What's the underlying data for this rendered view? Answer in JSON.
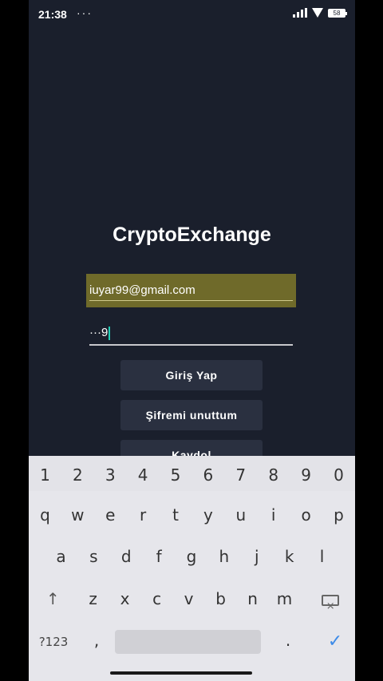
{
  "status": {
    "time": "21:38",
    "dots": "···",
    "battery": "58"
  },
  "app": {
    "title": "CryptoExchange"
  },
  "form": {
    "email_value": "iuyar99@gmail.com",
    "password_value": "···9",
    "login_label": "Giriş Yap",
    "forgot_label": "Şifremi unuttum",
    "register_label": "Kaydol"
  },
  "keyboard": {
    "numbers": [
      "1",
      "2",
      "3",
      "4",
      "5",
      "6",
      "7",
      "8",
      "9",
      "0"
    ],
    "row1": [
      "q",
      "w",
      "e",
      "r",
      "t",
      "y",
      "u",
      "i",
      "o",
      "p"
    ],
    "row2": [
      "a",
      "s",
      "d",
      "f",
      "g",
      "h",
      "j",
      "k",
      "l"
    ],
    "row3": [
      "z",
      "x",
      "c",
      "v",
      "b",
      "n",
      "m"
    ],
    "shift": "↑",
    "sym_label": "?123",
    "comma": ",",
    "period": ".",
    "done": "✓"
  }
}
